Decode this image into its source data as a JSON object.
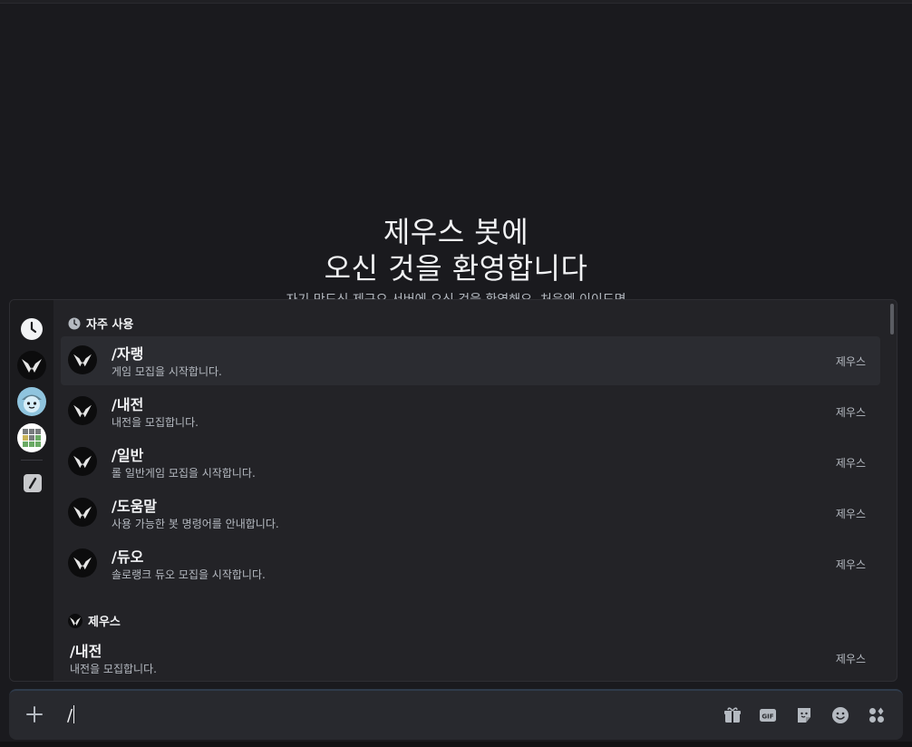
{
  "welcome": {
    "line1": "제우스 봇에",
    "line2": "오신 것을 환영합니다",
    "sub": "자기 만드신 제구오 서버에 오신 것을 환영해요. 처음엔 이이드면"
  },
  "rail": {
    "items": [
      {
        "name": "frequent-clock-icon"
      },
      {
        "name": "zeus-bot-icon"
      },
      {
        "name": "bot-mascot-icon"
      },
      {
        "name": "grid-bot-icon"
      },
      {
        "name": "builtin-slash-icon"
      }
    ]
  },
  "frequent": {
    "header": "자주 사용",
    "commands": [
      {
        "name": "/자랭",
        "desc": "게임 모집을 시작합니다.",
        "bot": "제우스"
      },
      {
        "name": "/내전",
        "desc": "내전을 모집합니다.",
        "bot": "제우스"
      },
      {
        "name": "/일반",
        "desc": "롤 일반게임 모집을 시작합니다.",
        "bot": "제우스"
      },
      {
        "name": "/도움말",
        "desc": "사용 가능한 봇 명령어를 안내합니다.",
        "bot": "제우스"
      },
      {
        "name": "/듀오",
        "desc": "솔로랭크 듀오 모집을 시작합니다.",
        "bot": "제우스"
      }
    ]
  },
  "zeus": {
    "header": "제우스",
    "commands": [
      {
        "name": "/내전",
        "desc": "내전을 모집합니다.",
        "bot": "제우스"
      }
    ]
  },
  "composer": {
    "value": "/",
    "tools": [
      "gift-icon",
      "gif-icon",
      "sticker-icon",
      "emoji-icon",
      "apps-icon"
    ]
  },
  "colors": {
    "background": "#1a1a1e",
    "popup": "#232327",
    "active_row": "#2b2c31",
    "composer": "#28292e"
  }
}
